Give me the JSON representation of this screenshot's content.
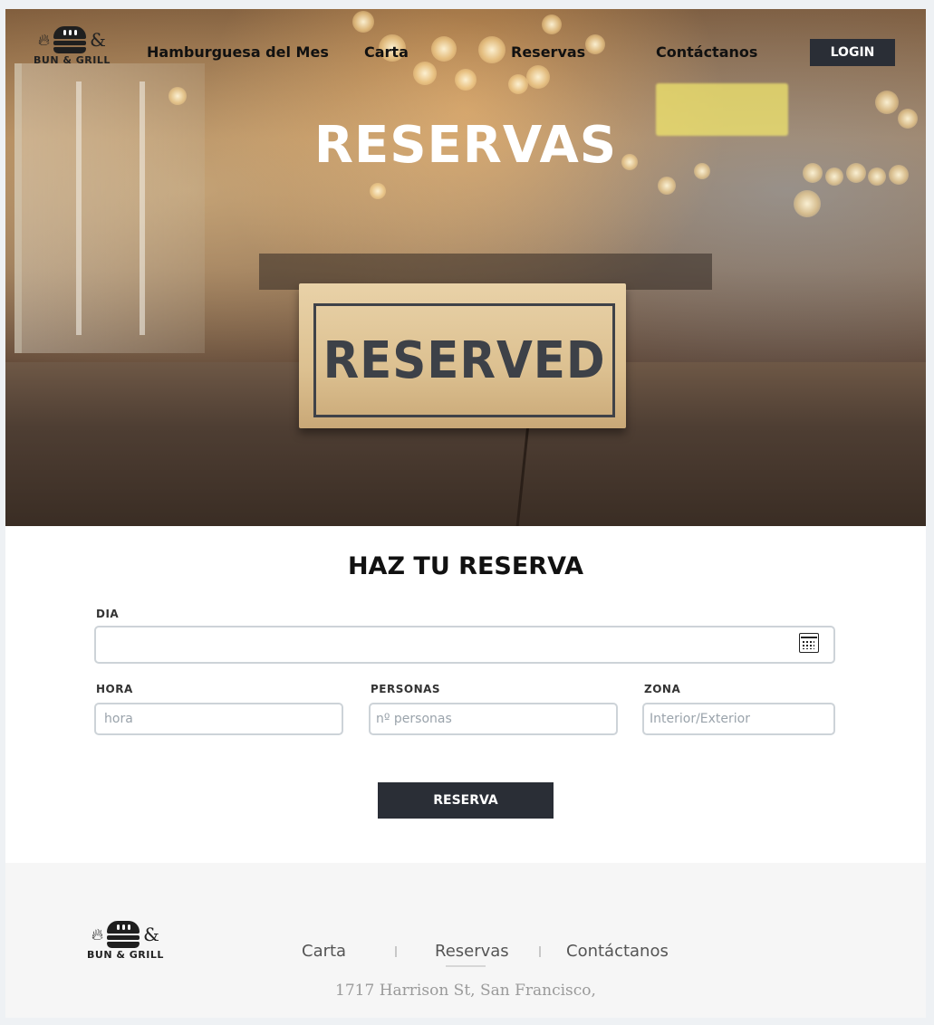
{
  "brand": {
    "logo_text": "BUN & GRILL",
    "amp": "&"
  },
  "nav": {
    "items": [
      {
        "label": "Hamburguesa del Mes"
      },
      {
        "label": "Carta"
      },
      {
        "label": "Reservas"
      },
      {
        "label": "Contáctanos"
      }
    ],
    "login_label": "LOGIN"
  },
  "hero": {
    "title": "RESERVAS",
    "sign_text": "RESERVED"
  },
  "form": {
    "title": "HAZ TU RESERVA",
    "dia": {
      "label": "DIA",
      "value": "",
      "placeholder": ""
    },
    "hora": {
      "label": "HORA",
      "placeholder": "hora"
    },
    "personas": {
      "label": "PERSONAS",
      "placeholder": "nº personas"
    },
    "zona": {
      "label": "ZONA",
      "placeholder": "Interior/Exterior"
    },
    "submit_label": "RESERVA"
  },
  "footer": {
    "links": [
      {
        "label": "Carta"
      },
      {
        "label": "Reservas"
      },
      {
        "label": "Contáctanos"
      }
    ],
    "active_link": "Reservas",
    "address": "1717 Harrison St, San Francisco,"
  },
  "colors": {
    "primary_dark": "#2a2e36",
    "field_border": "#cdd3d8",
    "footer_bg": "#f6f6f6"
  },
  "icons": {
    "calendar": "calendar-icon",
    "logo_burger": "burger-logo-icon",
    "logo_flame": "flame-icon"
  }
}
